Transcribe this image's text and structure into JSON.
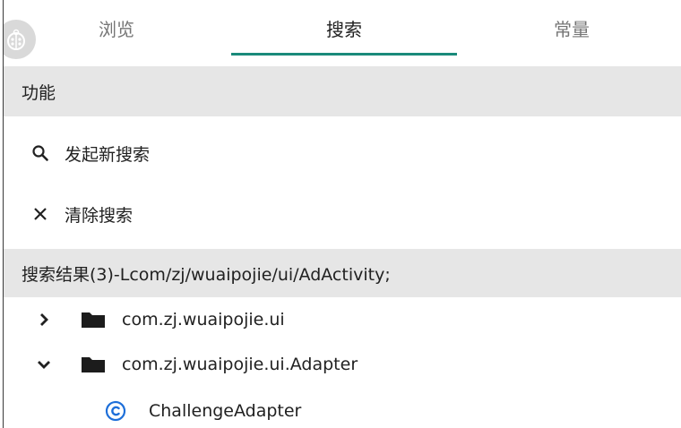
{
  "tabs": [
    {
      "label": "浏览",
      "active": false
    },
    {
      "label": "搜索",
      "active": true
    },
    {
      "label": "常量",
      "active": false
    }
  ],
  "accent_color": "#1a8a7a",
  "functions": {
    "header": "功能",
    "new_search": {
      "label": "发起新搜索",
      "icon": "search-icon"
    },
    "clear_search": {
      "label": "清除搜索",
      "icon": "close-icon"
    }
  },
  "results": {
    "header": "搜索结果(3)-Lcom/zj/wuaipojie/ui/AdActivity;",
    "items": [
      {
        "label": "com.zj.wuaipojie.ui",
        "type": "package",
        "expanded": false,
        "icon": "folder-icon"
      },
      {
        "label": "com.zj.wuaipojie.ui.Adapter",
        "type": "package",
        "expanded": true,
        "icon": "folder-icon"
      },
      {
        "label": "ChallengeAdapter",
        "type": "class",
        "icon": "class-icon"
      }
    ]
  }
}
